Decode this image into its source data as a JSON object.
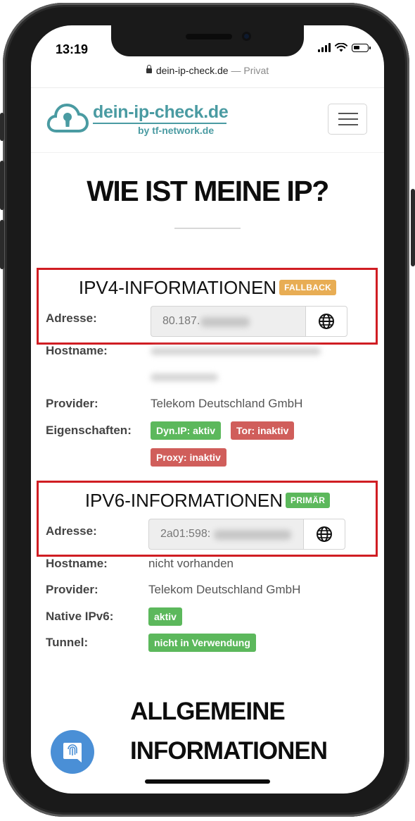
{
  "status_bar": {
    "time": "13:19"
  },
  "url_bar": {
    "domain": "dein-ip-check.de",
    "separator": " — ",
    "mode": "Privat"
  },
  "header": {
    "logo_title": "dein-ip-check.de",
    "logo_subtitle": "by tf-network.de",
    "menu_icon": "hamburger-menu-icon"
  },
  "page_title": "WIE IST MEINE IP?",
  "ipv4": {
    "title": "IPV4-INFORMATIONEN",
    "badge": "FALLBACK",
    "address_label": "Adresse:",
    "address_value": "80.187.",
    "hostname_label": "Hostname:",
    "provider_label": "Provider:",
    "provider_value": "Telekom Deutschland GmbH",
    "properties_label": "Eigenschaften:",
    "properties": [
      "Dyn.IP: aktiv",
      "Tor: inaktiv",
      "Proxy: inaktiv"
    ]
  },
  "ipv6": {
    "title": "IPV6-INFORMATIONEN",
    "badge": "PRIMÄR",
    "address_label": "Adresse:",
    "address_value": "2a01:598:",
    "hostname_label": "Hostname:",
    "hostname_value": "nicht vorhanden",
    "provider_label": "Provider:",
    "provider_value": "Telekom Deutschland GmbH",
    "native_label": "Native IPv6:",
    "native_value": "aktiv",
    "tunnel_label": "Tunnel:",
    "tunnel_value": "nicht in Verwendung"
  },
  "general": {
    "line1": "ALLGEMEINE",
    "line2": "INFORMATIONEN"
  },
  "colors": {
    "brand": "#4a9ba2",
    "fallback": "#e8ad54",
    "success": "#5cb85c",
    "danger": "#d05e5b",
    "highlight": "#d01d23",
    "chat": "#4a8fd6"
  }
}
